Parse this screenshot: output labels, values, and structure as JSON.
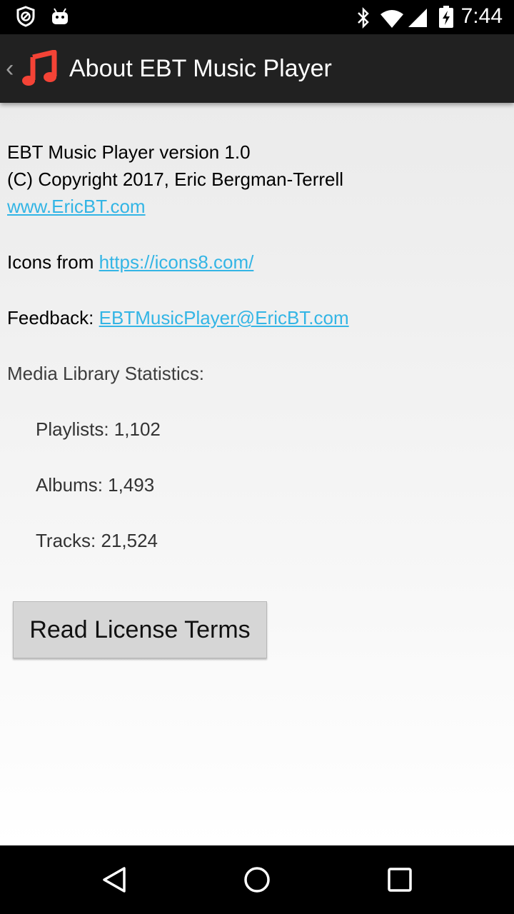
{
  "status_bar": {
    "time": "7:44",
    "icons": [
      "do-not-disturb-icon",
      "android-debug-icon",
      "bluetooth-icon",
      "wifi-icon",
      "cell-signal-icon",
      "battery-charging-icon"
    ]
  },
  "action_bar": {
    "title": "About EBT Music Player",
    "back_icon": "chevron-left-icon",
    "app_icon": "music-note-icon",
    "app_icon_color": "#f44336"
  },
  "about": {
    "version_line": "EBT Music Player version 1.0",
    "copyright_line": "(C) Copyright 2017, Eric Bergman-Terrell",
    "website_link": "www.EricBT.com",
    "icons_prefix": "Icons from ",
    "icons_link": "https://icons8.com/",
    "feedback_prefix": "Feedback: ",
    "feedback_link": "EBTMusicPlayer@EricBT.com"
  },
  "stats": {
    "heading": "Media Library Statistics:",
    "playlists": "Playlists: 1,102",
    "albums": "Albums: 1,493",
    "tracks": "Tracks: 21,524"
  },
  "license_button": {
    "label": "Read License Terms"
  },
  "nav_bar": {
    "icons": [
      "back-triangle-icon",
      "home-circle-icon",
      "recents-square-icon"
    ]
  },
  "colors": {
    "link": "#33b5e5",
    "action_bar": "#212121",
    "button": "#d6d6d6"
  }
}
